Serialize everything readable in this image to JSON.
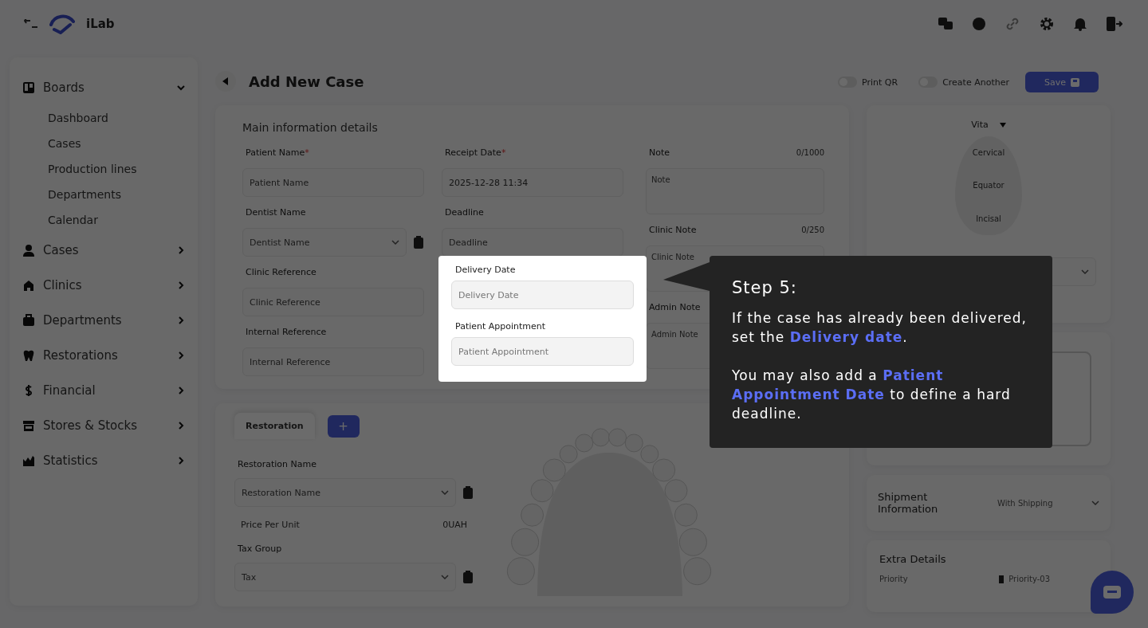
{
  "header": {
    "brand": "iLab"
  },
  "sidebar": {
    "items": [
      {
        "label": "Boards",
        "expanded": true,
        "children": [
          {
            "label": "Dashboard"
          },
          {
            "label": "Cases"
          },
          {
            "label": "Production lines"
          },
          {
            "label": "Departments"
          },
          {
            "label": "Calendar"
          }
        ]
      },
      {
        "label": "Cases",
        "expanded": false
      },
      {
        "label": "Clinics",
        "expanded": false
      },
      {
        "label": "Departments",
        "expanded": false
      },
      {
        "label": "Restorations",
        "expanded": false
      },
      {
        "label": "Financial",
        "expanded": false
      },
      {
        "label": "Stores & Stocks",
        "expanded": false
      },
      {
        "label": "Statistics",
        "expanded": false
      }
    ]
  },
  "page": {
    "title": "Add New Case",
    "toggles": [
      {
        "label": "Print QR",
        "on": false
      },
      {
        "label": "Create Another",
        "on": false
      }
    ],
    "save_button": "Save"
  },
  "main_info": {
    "required_mark": "*",
    "title": "Main information details",
    "columns": [
      [
        {
          "kind": "text",
          "label": "Patient Name",
          "required": true,
          "placeholder": "Patient Name"
        },
        {
          "kind": "select",
          "label": "Dentist Name",
          "required": false,
          "placeholder": "Dentist Name"
        },
        {
          "kind": "text",
          "label": "Clinic Reference",
          "required": false,
          "placeholder": "Clinic Reference"
        },
        {
          "kind": "text",
          "label": "Internal Reference",
          "required": false,
          "placeholder": "Internal Reference"
        }
      ],
      [
        {
          "kind": "text",
          "label": "Receipt Date",
          "required": true,
          "value": "2025-12-28 11:34"
        },
        {
          "kind": "text",
          "label": "Deadline",
          "required": false,
          "placeholder": "Deadline"
        }
      ],
      [
        {
          "kind": "textarea",
          "label": "Note",
          "required": false,
          "counter": "0/1000",
          "placeholder": "Note"
        },
        {
          "kind": "textarea",
          "label": "Clinic Note",
          "required": false,
          "counter": "0/250",
          "placeholder": "Clinic Note"
        },
        {
          "kind": "textarea",
          "label": "Admin Note",
          "required": false,
          "placeholder": "Admin Note"
        }
      ]
    ]
  },
  "highlight": {
    "fields": [
      {
        "label": "Delivery Date",
        "placeholder": "Delivery Date"
      },
      {
        "label": "Patient Appointment",
        "placeholder": "Patient Appointment"
      }
    ]
  },
  "tooltip": {
    "title": "Step 5:",
    "paragraphs": [
      "If the case has already been delivered, set the **Delivery date**.",
      "You may also add a **Patient Appointment Date** to define a hard deadline."
    ]
  },
  "restoration": {
    "tabs": [
      {
        "label": "Restoration",
        "selected": true
      }
    ],
    "add_button": "+",
    "fields": [
      {
        "kind": "select",
        "label": "Restoration Name",
        "placeholder": "Restoration Name"
      },
      {
        "kind": "readout",
        "label": "Price Per Unit",
        "value": "0UAH"
      },
      {
        "kind": "select",
        "label": "Tax Group",
        "placeholder": "Tax"
      }
    ]
  },
  "shade": {
    "system": "Vita",
    "zones": [
      "Cervical",
      "Equator",
      "Incisal"
    ]
  },
  "shipment": {
    "title": "Shipment Information",
    "value": "With Shipping"
  },
  "extra": {
    "title": "Extra Details",
    "rows": [
      {
        "label": "Priority",
        "value": "Priority-03"
      }
    ]
  }
}
